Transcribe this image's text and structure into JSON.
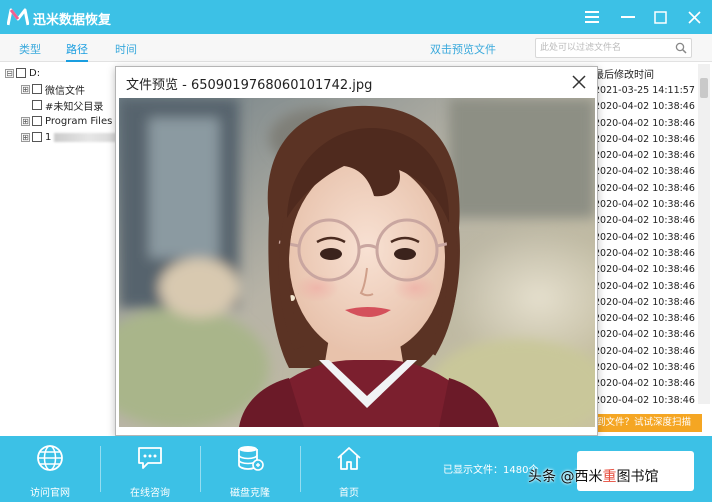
{
  "app": {
    "title": "迅米数据恢复"
  },
  "window_controls": [
    "menu-icon",
    "minimize-icon",
    "maximize-icon",
    "close-icon"
  ],
  "tabs": [
    {
      "label": "类型",
      "active": false
    },
    {
      "label": "路径",
      "active": true
    },
    {
      "label": "时间",
      "active": false
    }
  ],
  "toolbar": {
    "double_click_preview": "双击预览文件"
  },
  "search": {
    "placeholder": "此处可以过滤文件名"
  },
  "tree": {
    "root": {
      "label": "D:",
      "expander": "⊟"
    },
    "children": [
      {
        "label": "微信文件",
        "expander": "⊞"
      },
      {
        "label": "#未知父目录",
        "expander": ""
      },
      {
        "label": "Program Files (",
        "expander": "⊞"
      },
      {
        "label": "1",
        "expander": "⊞"
      }
    ]
  },
  "file_list": {
    "column_header": "最后修改时间",
    "timestamps": [
      "2021-03-25 14:11:57",
      "2020-04-02 10:38:46",
      "2020-04-02 10:38:46",
      "2020-04-02 10:38:46",
      "2020-04-02 10:38:46",
      "2020-04-02 10:38:46",
      "2020-04-02 10:38:46",
      "2020-04-02 10:38:46",
      "2020-04-02 10:38:46",
      "2020-04-02 10:38:46",
      "2020-04-02 10:38:46",
      "2020-04-02 10:38:46",
      "2020-04-02 10:38:46",
      "2020-04-02 10:38:46",
      "2020-04-02 10:38:46",
      "2020-04-02 10:38:46",
      "2020-04-02 10:38:46",
      "2020-04-02 10:38:46",
      "2020-04-02 10:38:46",
      "2020-04-02 10:38:46"
    ]
  },
  "deep_scan_banner": "到文件？试试深度扫描",
  "preview_dialog": {
    "title": "文件预览 - 6509019768060101742.jpg"
  },
  "bottom_nav": [
    {
      "label": "访问官网",
      "icon": "globe-icon"
    },
    {
      "label": "在线咨询",
      "icon": "chat-icon"
    },
    {
      "label": "磁盘克隆",
      "icon": "database-icon"
    },
    {
      "label": "首页",
      "icon": "home-icon"
    }
  ],
  "status": {
    "file_count": "已显示文件：1480个"
  },
  "watermark": {
    "prefix": "头条 @西米",
    "highlight": "重",
    "suffix": "图书馆"
  },
  "colors": {
    "accent": "#3cc1e6",
    "tab_active": "#1a9ee0",
    "deep_scan": "#f5a623"
  }
}
